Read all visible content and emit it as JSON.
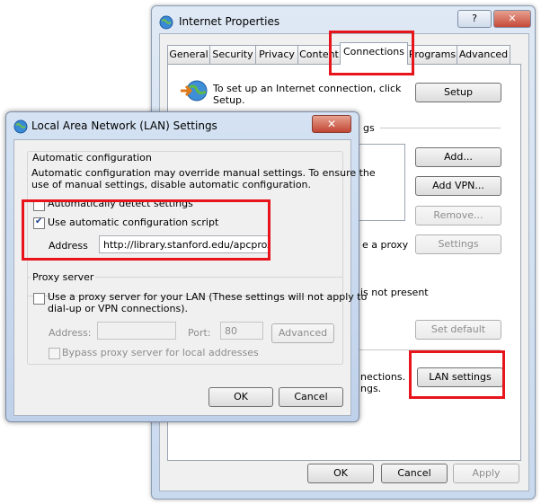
{
  "internet_properties": {
    "title": "Internet Properties",
    "help": "?",
    "close": "✕",
    "tabs": [
      "General",
      "Security",
      "Privacy",
      "Content",
      "Connections",
      "Programs",
      "Advanced"
    ],
    "active_tab": "Connections",
    "setup_text_line1": "To set up an Internet connection, click",
    "setup_text_line2": "Setup.",
    "setup_button": "Setup",
    "dialup_section_suffix": "gs",
    "add_button": "Add...",
    "add_vpn_button": "Add VPN...",
    "remove_button": "Remove...",
    "settings_button": "Settings",
    "proxy_fragment": "e a proxy",
    "not_present_fragment": "is not present",
    "set_default_button": "Set default",
    "lan_fragment_line1": "nections.",
    "lan_fragment_line2": "ngs.",
    "lan_settings_button": "LAN settings",
    "ok_button": "OK",
    "cancel_button": "Cancel",
    "apply_button": "Apply"
  },
  "lan_dialog": {
    "title": "Local Area Network (LAN) Settings",
    "close": "✕",
    "auto_config_heading": "Automatic configuration",
    "auto_config_desc_line1": "Automatic configuration may override manual settings.  To ensure the",
    "auto_config_desc_line2": "use of manual settings, disable automatic configuration.",
    "auto_detect_label": "Automatically detect settings",
    "use_script_label": "Use automatic configuration script",
    "address_label": "Address",
    "address_value": "http://library.stanford.edu/apcproxy.",
    "proxy_heading": "Proxy server",
    "use_proxy_label_line1": "Use a proxy server for your LAN (These settings will not apply to",
    "use_proxy_label_line2": "dial-up or VPN connections).",
    "proxy_address_label": "Address:",
    "proxy_port_label": "Port:",
    "proxy_port_value": "80",
    "advanced_button": "Advanced",
    "bypass_label": "Bypass proxy server for local addresses",
    "ok_button": "OK",
    "cancel_button": "Cancel"
  },
  "colors": {
    "highlight": "#e8141b",
    "title_bar": "#c9d9ee"
  }
}
